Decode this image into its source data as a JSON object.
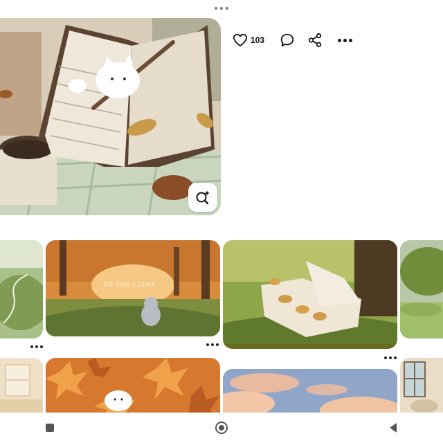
{
  "pin": {
    "image_desc_icon": "cozy-autumn-notebook-illustration",
    "likes": "103"
  },
  "icons": {
    "like": "heart-icon",
    "comment": "comment-icon",
    "share": "share-icon",
    "more": "more-icon",
    "visual_search": "visual-search-icon"
  },
  "grid": {
    "row1": [
      {
        "name": "pin-tile-forest-left"
      },
      {
        "name": "pin-tile-autumn-woods",
        "caption": "TO THE LIGHT"
      },
      {
        "name": "pin-tile-open-book"
      },
      {
        "name": "pin-tile-meadow-right"
      }
    ],
    "row2": [
      {
        "name": "pin-tile-room-left"
      },
      {
        "name": "pin-tile-maple-leaves"
      },
      {
        "name": "pin-tile-sky-clouds"
      },
      {
        "name": "pin-tile-window-right"
      }
    ]
  },
  "colors": {
    "autumn_orange": "#c9782e",
    "forest_green": "#6f8d3b",
    "sky_blue": "#8fa6c9",
    "cream": "#efe6d6"
  }
}
